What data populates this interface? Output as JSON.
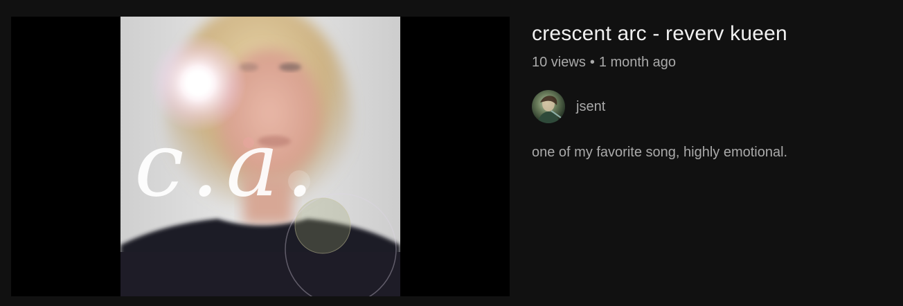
{
  "video": {
    "title": "crescent arc - reverv kueen",
    "views": "10 views",
    "separator": "•",
    "age": "1 month ago",
    "channel": "jsent",
    "description": "one of my favorite song, highly emotional.",
    "thumbnail_text": "c.a."
  }
}
